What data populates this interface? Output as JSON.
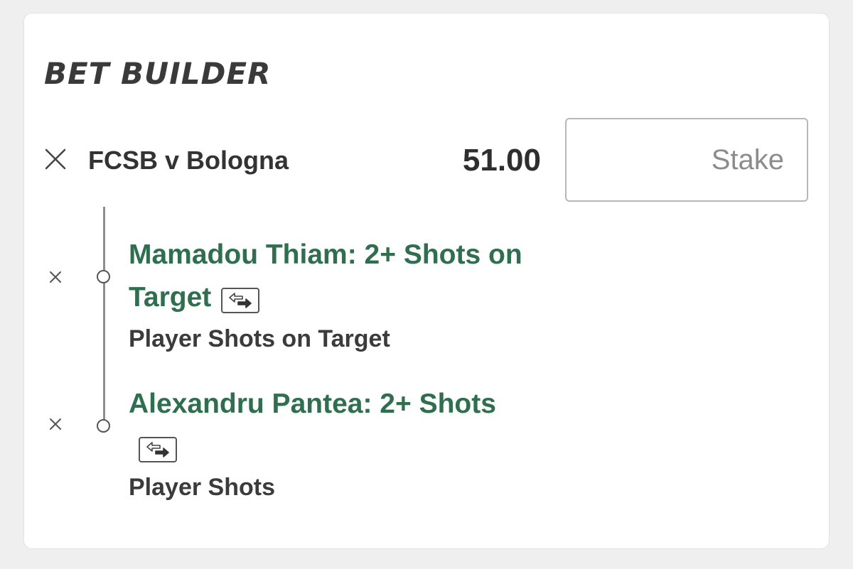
{
  "title": "BET BUILDER",
  "match": {
    "name": "FCSB v Bologna",
    "odds": "51.00"
  },
  "stake": {
    "placeholder": "Stake",
    "value": ""
  },
  "legs": [
    {
      "selection": "Mamadou Thiam: 2+ Shots on Target",
      "market": "Player Shots on Target"
    },
    {
      "selection": "Alexandru Pantea: 2+ Shots",
      "market": "Player Shots"
    }
  ],
  "icons": {
    "remove": "close-icon",
    "swap": "swap-icon"
  },
  "colors": {
    "selection_green": "#2f6e4f",
    "background": "#efefef",
    "card": "#ffffff"
  }
}
